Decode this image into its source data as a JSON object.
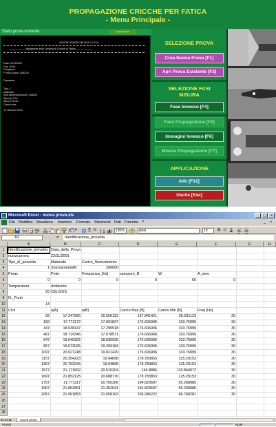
{
  "app": {
    "title_line1": "PROPAGAZIONE CRICCHE PER FATICA",
    "title_line2": "- Menu Principale -",
    "status_label": "Stato prova corrente",
    "status_value": "nuova prova",
    "console": {
      "header": "CENTRO RICERCHE FIAT S.C.P.A.",
      "subheader": "------------------- Valutazione della Crescita di Cricche di Fatica -------------------",
      "info_lines": [
        "Data: 22/11/2001",
        "Ora: 23.06",
        "Campione:",
        "F nella sonna: 2000.00"
      ],
      "operator_label": "Operatore:",
      "spec_lines": [
        "Tipo: 1",
        "Materiale:",
        "Snervamento[N/mm2]: 206000",
        "W[mm]: 0.00",
        "A[mm]: 50.00",
        "Carico max:"
      ],
      "tv_line": "TV camera: A 5.8"
    },
    "menu": {
      "section_prova": "SELEZIONE PROVA",
      "btn_new": "Crea Nuova Prova [F1]",
      "btn_open": "Apri Prova Esistente [F2]",
      "section_fasi": "SELEZIONE FASI MISURA",
      "btn_innesco": "Fase Innesco [F4]",
      "btn_propagazione": "Fase Propagazione [F5]",
      "btn_immagini": "Immagini Innesco [F6]",
      "btn_misura": "Misura Propagazione [F7]",
      "section_app": "APPLICAZIONE",
      "btn_info": "Info [F12]",
      "btn_exit": "Uscita [Esc]"
    }
  },
  "excel": {
    "window_title": "Microsoft Excel - nuova prova.xls",
    "menus": [
      "File",
      "Modifica",
      "Visualizza",
      "Inserisci",
      "Formato",
      "Strumenti",
      "Dati",
      "Finestra",
      "?"
    ],
    "font_name": "Arial",
    "font_size": "10",
    "zoom": "100%",
    "name_box": "A1",
    "formula": "Identificazione_provetta",
    "columns": [
      "A",
      "B",
      "C",
      "D",
      "E",
      "F",
      "G",
      "H"
    ],
    "rows": [
      {
        "n": "1",
        "c": [
          "Identificazione_provetta",
          "Data_della_Prova",
          "",
          "",
          "",
          "",
          ""
        ]
      },
      {
        "n": "2",
        "c": [
          "nuova prova",
          "22/11/2001",
          "",
          "",
          "",
          "",
          ""
        ]
      },
      {
        "n": "3",
        "c": [
          "Tipo_di_provetta",
          "Materiale",
          "Carico_Snervamento",
          "",
          "",
          "",
          ""
        ]
      },
      {
        "n": "4",
        "c": [
          "1",
          "Snervamento[N",
          "206000",
          "",
          "",
          "",
          ""
        ]
      },
      {
        "n": "5",
        "c": [
          "Pmax",
          "Pmin",
          "Frequenza_[Hz]",
          "spessore_B",
          "W",
          "A_zero",
          ""
        ]
      },
      {
        "n": "6",
        "c": [
          "0",
          "0",
          "0",
          "0",
          "50",
          "0",
          ""
        ]
      },
      {
        "n": "7",
        "c": [
          "Temperatura",
          "Ambiente",
          "",
          "",
          "",
          "",
          ""
        ]
      },
      {
        "n": "8",
        "c": [
          "25",
          "CELSIUS",
          "",
          "",
          "",
          "",
          ""
        ]
      },
      {
        "n": "9",
        "c": [
          "N._Punti",
          "",
          "",
          "",
          "",
          "",
          ""
        ]
      },
      {
        "n": "10",
        "c": [
          "14",
          "",
          "",
          "",
          "",
          "",
          ""
        ]
      },
      {
        "n": "11",
        "c": [
          "Cicli",
          "a(A)",
          "a(B)",
          "Carico Max [N]",
          "Carico Min [N]",
          "Freq [Hz]",
          ""
        ]
      },
      {
        "n": "12",
        "c": [
          "92",
          "17.247966",
          "16.556122",
          "137.841421",
          "55.531123",
          "30",
          ""
        ]
      },
      {
        "n": "13",
        "c": [
          "182",
          "17.771172",
          "17.091837",
          "176.606906",
          "103.76999",
          "30",
          ""
        ]
      },
      {
        "n": "14",
        "c": [
          "347",
          "18.038147",
          "17.295918",
          "176.606906",
          "103.76999",
          "30",
          ""
        ]
      },
      {
        "n": "15",
        "c": [
          "467",
          "18.719346",
          "17.678571",
          "176.606906",
          "103.76999",
          "30",
          ""
        ]
      },
      {
        "n": "16",
        "c": [
          "647",
          "19.046322",
          "18.596939",
          "176.606906",
          "103.76999",
          "30",
          ""
        ]
      },
      {
        "n": "17",
        "c": [
          "857",
          "19.673025",
          "19.209184",
          "176.606906",
          "103.76999",
          "30",
          ""
        ]
      },
      {
        "n": "18",
        "c": [
          "1097",
          "20.027248",
          "19.821429",
          "176.606906",
          "103.76999",
          "30",
          ""
        ]
      },
      {
        "n": "19",
        "c": [
          "1157",
          "20.354223",
          "19.94898",
          "178.783853",
          "125.29153",
          "30",
          ""
        ]
      },
      {
        "n": "20",
        "c": [
          "1367",
          "20.762943",
          "19.94898",
          "178.783853",
          "125.29153",
          "30",
          ""
        ]
      },
      {
        "n": "21",
        "c": [
          "1577",
          "21.171662",
          "20.510204",
          "146.8886",
          "110.844072",
          "30",
          ""
        ]
      },
      {
        "n": "22",
        "c": [
          "1697",
          "21.852125",
          "20.688776",
          "178.783853",
          "125.29153",
          "30",
          ""
        ]
      },
      {
        "n": "23",
        "c": [
          "1757",
          "21.771117",
          "20.765306",
          "194.823697",
          "55.268985",
          "30",
          ""
        ]
      },
      {
        "n": "24",
        "c": [
          "1967",
          "21.852861",
          "21.352041",
          "194.823697",
          "55.268985",
          "30",
          ""
        ]
      },
      {
        "n": "25",
        "c": [
          "2057",
          "21.961853",
          "21.658163",
          "106.086222",
          "66.768281",
          "30",
          ""
        ]
      },
      {
        "n": "26",
        "c": [
          "",
          "",
          "",
          "",
          "",
          "",
          ""
        ]
      },
      {
        "n": "27",
        "c": [
          "",
          "",
          "",
          "",
          "",
          "",
          ""
        ]
      },
      {
        "n": "28",
        "c": [
          "",
          "",
          "",
          "",
          "",
          "",
          ""
        ]
      }
    ],
    "sheet_tab": "nuova prova",
    "status_text": "Pronto",
    "num_indicator": "NUM"
  }
}
